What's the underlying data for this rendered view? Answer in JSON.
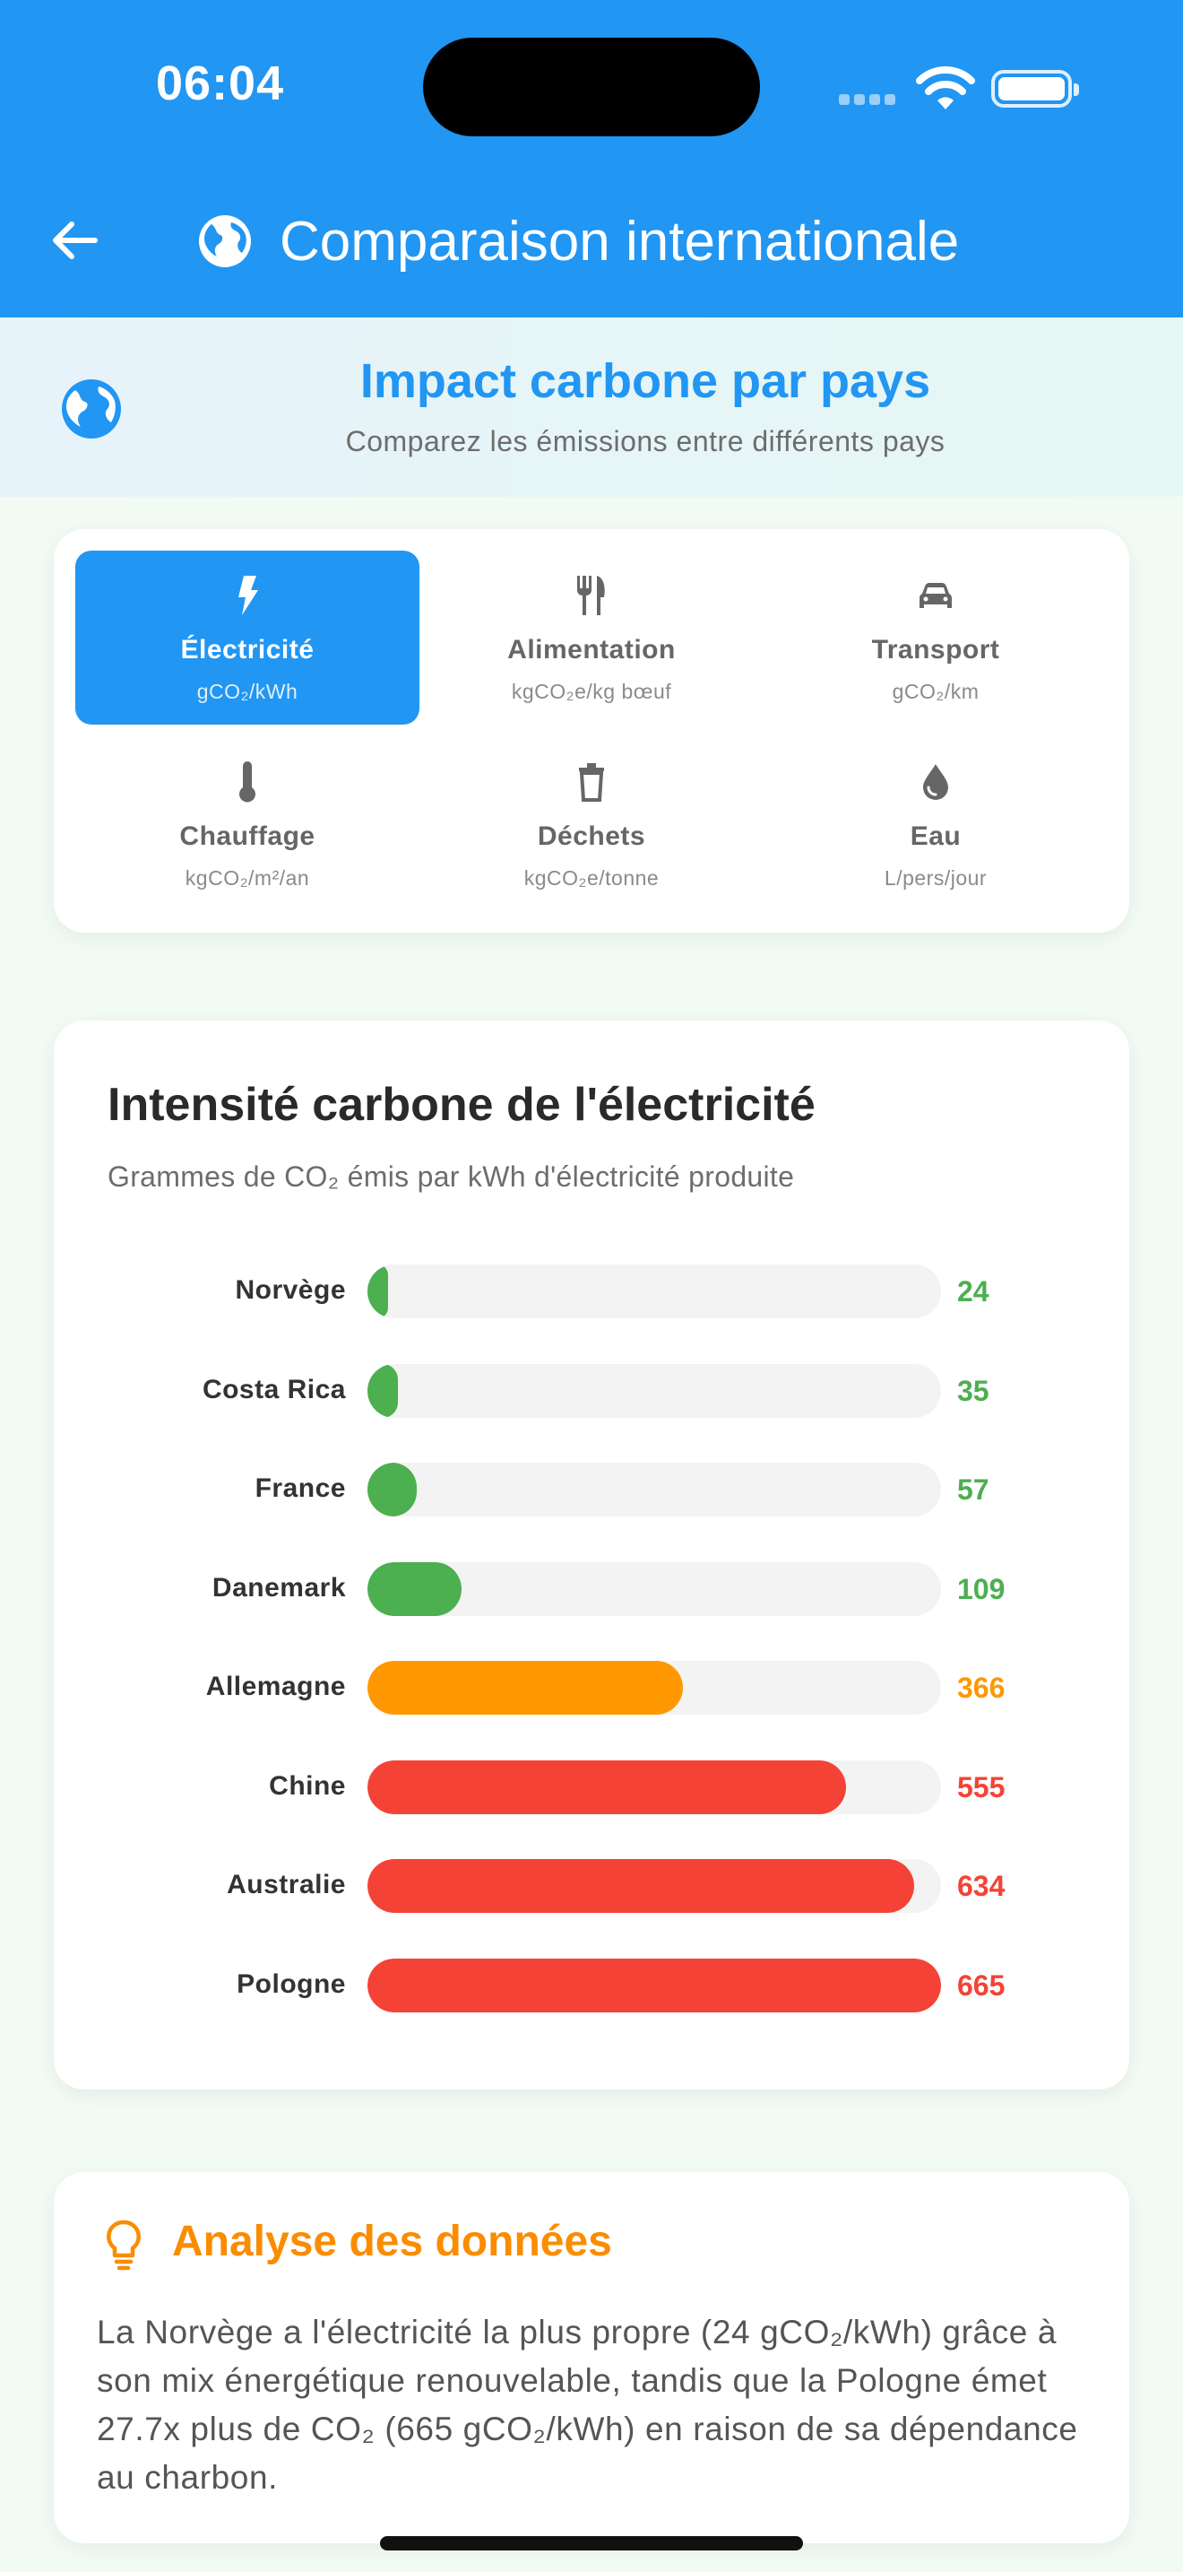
{
  "status_bar": {
    "time": "06:04"
  },
  "header": {
    "title": "Comparaison internationale"
  },
  "banner": {
    "title": "Impact carbone par pays",
    "subtitle": "Comparez les émissions entre différents pays"
  },
  "categories": [
    {
      "label": "Électricité",
      "unit": "gCO₂/kWh",
      "icon": "bolt-icon",
      "active": true
    },
    {
      "label": "Alimentation",
      "unit": "kgCO₂e/kg bœuf",
      "icon": "fork-knife-icon",
      "active": false
    },
    {
      "label": "Transport",
      "unit": "gCO₂/km",
      "icon": "car-icon",
      "active": false
    },
    {
      "label": "Chauffage",
      "unit": "kgCO₂/m²/an",
      "icon": "thermometer-icon",
      "active": false
    },
    {
      "label": "Déchets",
      "unit": "kgCO₂e/tonne",
      "icon": "trash-icon",
      "active": false
    },
    {
      "label": "Eau",
      "unit": "L/pers/jour",
      "icon": "water-drop-icon",
      "active": false
    }
  ],
  "chart": {
    "title": "Intensité carbone de l'électricité",
    "subtitle": "Grammes de CO₂ émis par kWh d'électricité produite"
  },
  "chart_data": {
    "type": "bar",
    "orientation": "horizontal",
    "categories": [
      "Norvège",
      "Costa Rica",
      "France",
      "Danemark",
      "Allemagne",
      "Chine",
      "Australie",
      "Pologne"
    ],
    "values": [
      24,
      35,
      57,
      109,
      366,
      555,
      634,
      665
    ],
    "value_labels": [
      "24",
      "35",
      "57",
      "109",
      "366",
      "555",
      "634",
      "665"
    ],
    "colors": [
      "#4caf50",
      "#4caf50",
      "#4caf50",
      "#4caf50",
      "#ff9800",
      "#f44336",
      "#f44336",
      "#f44336"
    ],
    "xlim": [
      0,
      665
    ],
    "grid": false
  },
  "analysis": {
    "title": "Analyse des données",
    "text": "La Norvège a l'électricité la plus propre (24 gCO₂/kWh) grâce à son mix énergétique renouvelable, tandis que la Pologne émet 27.7x plus de CO₂ (665 gCO₂/kWh) en raison de sa dépendance au charbon."
  },
  "colors": {
    "primary": "#2196f3",
    "low": "#4caf50",
    "medium": "#ff9800",
    "high": "#f44336",
    "accent": "#fb8c00"
  }
}
